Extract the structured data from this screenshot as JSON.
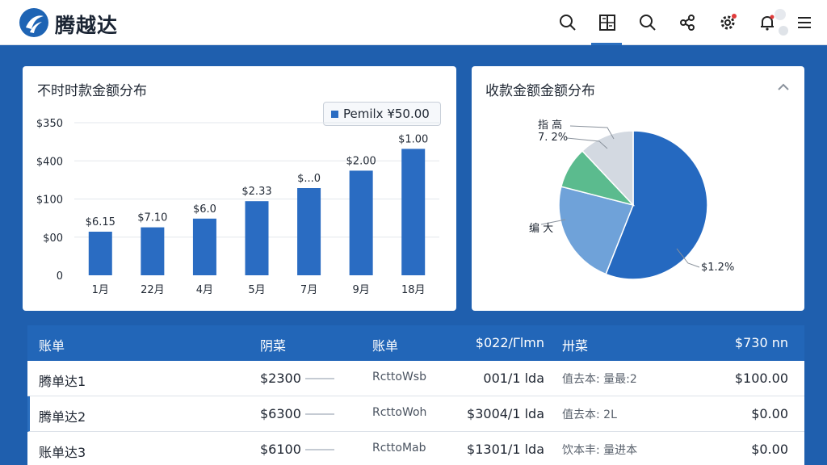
{
  "header": {
    "brand": "腾越达",
    "icons": [
      "search-icon",
      "grid-icon",
      "search-icon",
      "share-icon",
      "settings-icon",
      "bell-icon",
      "avatar",
      "menu-icon"
    ]
  },
  "bar_card": {
    "title": "不时时款金额分布",
    "legend": "Pemilx ¥50.00"
  },
  "pie_card": {
    "title": "收款金额金额分布",
    "labels": {
      "top_line1": "指 高",
      "top_line2": "7. 2%",
      "left": "编 大",
      "right": "$1.2%"
    }
  },
  "chart_data": [
    {
      "type": "bar",
      "title": "不时时款金额分布",
      "categories": [
        "1月",
        "22月",
        "4月",
        "5月",
        "7月",
        "9月",
        "18月"
      ],
      "values": [
        1.0,
        1.1,
        1.3,
        1.7,
        2.0,
        2.4,
        2.9
      ],
      "data_labels": [
        "$6.15",
        "$7.10",
        "$6.0",
        "$2.33",
        "$...0",
        "$2.00",
        "$1.00"
      ],
      "yticks": [
        "$350",
        "$400",
        "$100",
        "$00",
        "0"
      ],
      "ylim": [
        0,
        3.5
      ],
      "grid": true,
      "legend": "top-right",
      "legend_text": "Pemilx ¥50.00",
      "color": "#2a6cc2"
    },
    {
      "type": "pie",
      "title": "收款金额金额分布",
      "slices": [
        {
          "label": "$1.2%",
          "value": 56,
          "color": "#2569c0"
        },
        {
          "label": "编 大",
          "value": 23,
          "color": "#6fa2d9"
        },
        {
          "label": "7. 2%",
          "value": 9,
          "color": "#5bbb8e"
        },
        {
          "label": "指 高",
          "value": 12,
          "color": "#d3d9e1"
        }
      ]
    }
  ],
  "table": {
    "headers": [
      "账单",
      "阴菜",
      "账单",
      "$022/Γlmn",
      "卅菜",
      "$730 nn"
    ],
    "rows": [
      [
        "腾单达1",
        "$2300",
        "RcttoWsb",
        "001/1 lda",
        "值去本: 量最:2",
        "$100.00"
      ],
      [
        "腾单达2",
        "$6300",
        "RcttoWoh",
        "$3004/1 lda",
        "值去本: 2L",
        "$0.00"
      ],
      [
        "账单达3",
        "$6100",
        "RcttoMab",
        "$1301/1 lda",
        "饮本丰: 量进本",
        "$0.00"
      ]
    ]
  }
}
